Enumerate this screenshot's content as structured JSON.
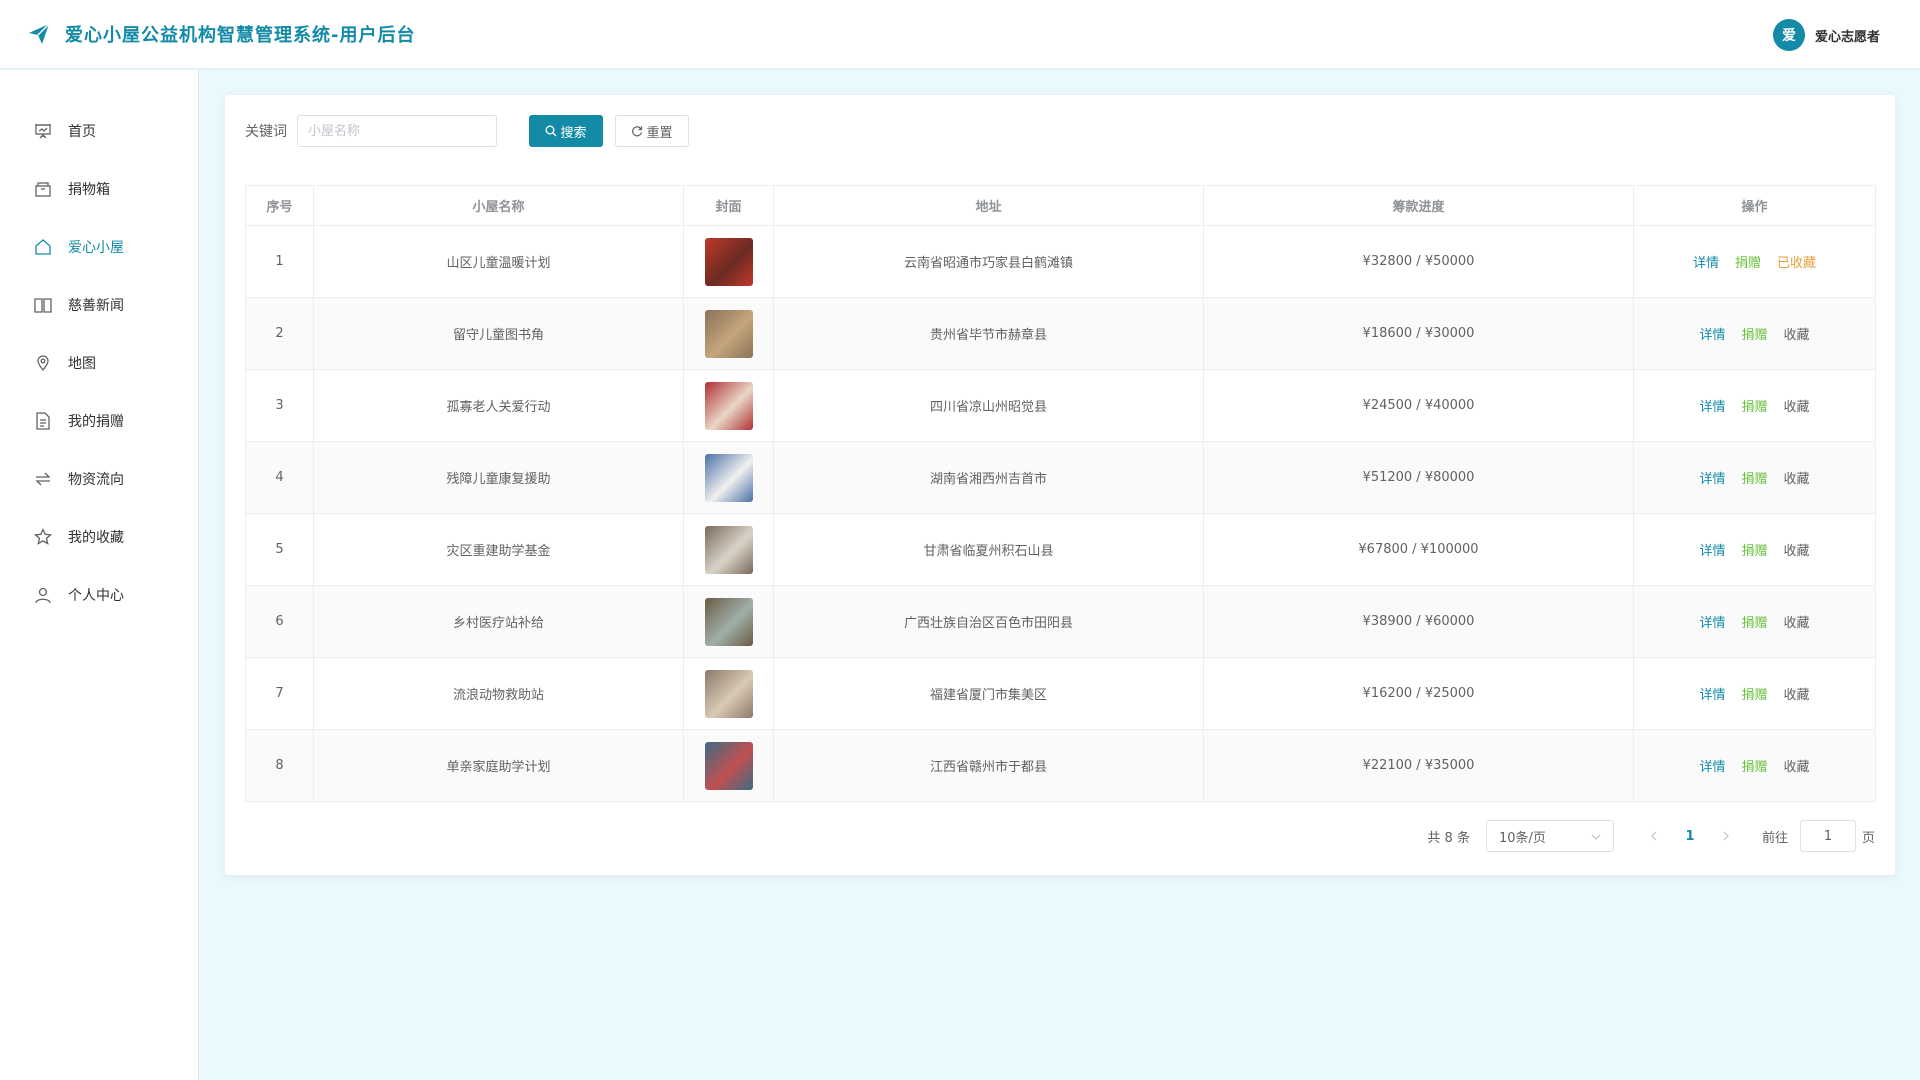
{
  "header": {
    "title": "爱心小屋公益机构智慧管理系统-用户后台",
    "user_avatar": "爱",
    "user_name": "爱心志愿者",
    "brand_color": "#138aa6"
  },
  "sidebar": {
    "items": [
      {
        "label": "首页",
        "icon": "presentation-icon",
        "active": false
      },
      {
        "label": "捐物箱",
        "icon": "box-icon",
        "active": false
      },
      {
        "label": "爱心小屋",
        "icon": "home-icon",
        "active": true
      },
      {
        "label": "慈善新闻",
        "icon": "book-icon",
        "active": false
      },
      {
        "label": "地图",
        "icon": "location-icon",
        "active": false
      },
      {
        "label": "我的捐赠",
        "icon": "document-icon",
        "active": false
      },
      {
        "label": "物资流向",
        "icon": "flow-icon",
        "active": false
      },
      {
        "label": "我的收藏",
        "icon": "star-icon",
        "active": false
      },
      {
        "label": "个人中心",
        "icon": "user-icon",
        "active": false
      }
    ]
  },
  "search": {
    "label": "关键词",
    "placeholder": "小屋名称",
    "value": "",
    "search_button": "搜索",
    "reset_button": "重置"
  },
  "table": {
    "headers": [
      "序号",
      "小屋名称",
      "封面",
      "地址",
      "筹款进度",
      "操作"
    ],
    "rows": [
      {
        "index": "1",
        "name": "山区儿童温暖计划",
        "address": "云南省昭通市巧家县白鹤滩镇",
        "progress": "¥32800 / ¥50000",
        "detail": "详情",
        "donate": "捐赠",
        "fav": "已收藏",
        "faved": true
      },
      {
        "index": "2",
        "name": "留守儿童图书角",
        "address": "贵州省毕节市赫章县",
        "progress": "¥18600 / ¥30000",
        "detail": "详情",
        "donate": "捐赠",
        "fav": "收藏",
        "faved": false
      },
      {
        "index": "3",
        "name": "孤寡老人关爱行动",
        "address": "四川省凉山州昭觉县",
        "progress": "¥24500 / ¥40000",
        "detail": "详情",
        "donate": "捐赠",
        "fav": "收藏",
        "faved": false
      },
      {
        "index": "4",
        "name": "残障儿童康复援助",
        "address": "湖南省湘西州吉首市",
        "progress": "¥51200 / ¥80000",
        "detail": "详情",
        "donate": "捐赠",
        "fav": "收藏",
        "faved": false
      },
      {
        "index": "5",
        "name": "灾区重建助学基金",
        "address": "甘肃省临夏州积石山县",
        "progress": "¥67800 / ¥100000",
        "detail": "详情",
        "donate": "捐赠",
        "fav": "收藏",
        "faved": false
      },
      {
        "index": "6",
        "name": "乡村医疗站补给",
        "address": "广西壮族自治区百色市田阳县",
        "progress": "¥38900 / ¥60000",
        "detail": "详情",
        "donate": "捐赠",
        "fav": "收藏",
        "faved": false
      },
      {
        "index": "7",
        "name": "流浪动物救助站",
        "address": "福建省厦门市集美区",
        "progress": "¥16200 / ¥25000",
        "detail": "详情",
        "donate": "捐赠",
        "fav": "收藏",
        "faved": false
      },
      {
        "index": "8",
        "name": "单亲家庭助学计划",
        "address": "江西省赣州市于都县",
        "progress": "¥22100 / ¥35000",
        "detail": "详情",
        "donate": "捐赠",
        "fav": "收藏",
        "faved": false
      }
    ]
  },
  "pagination": {
    "total": "共 8 条",
    "page_size": "10条/页",
    "current_page": "1",
    "goto_label": "前往",
    "goto_value": "1",
    "page_unit": "页"
  }
}
